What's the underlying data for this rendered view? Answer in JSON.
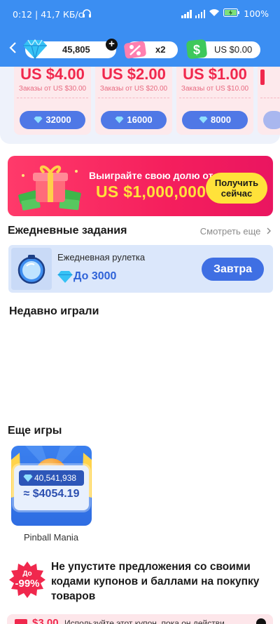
{
  "status_bar": {
    "time_speed": "0:12 | 41,7 КБ/с",
    "battery": "100%"
  },
  "header": {
    "gems": "45,805",
    "boost": "x2",
    "cash": "US $0.00",
    "colors": {
      "background": "#3b8ef2",
      "pill": "#ffffff"
    }
  },
  "coupons": [
    {
      "amount": "US $4.00",
      "condition": "Заказы от US $30.00",
      "price": "32000"
    },
    {
      "amount": "US $2.00",
      "condition": "Заказы от US $20.00",
      "price": "16000"
    },
    {
      "amount": "US $1.00",
      "condition": "Заказы от US $10.00",
      "price": "8000"
    }
  ],
  "banner": {
    "line1": "Выиграйте свою долю от",
    "line2": "US $1,000,000",
    "cta_line1": "Получить",
    "cta_line2": "сейчас",
    "colors": {
      "background": "#f51f5d",
      "accent": "#ffe23a"
    }
  },
  "daily_tasks": {
    "title": "Ежедневные задания",
    "see_all": "Смотреть еще",
    "task": {
      "name": "Ежедневная рулетка",
      "reward": "До 3000",
      "button": "Завтра"
    }
  },
  "recently_played": {
    "title": "Недавно играли"
  },
  "more_games": {
    "title": "Еще игры",
    "games": [
      {
        "name": "Pinball Mania",
        "count": "40,541,938",
        "usd": "≈ $4054.19"
      }
    ]
  },
  "offer": {
    "badge_line1": "До",
    "badge_line2": "-99%",
    "text": "Не упустите предложения со своими кодами купонов и баллами на покупку товаров"
  },
  "bottom_coupon": {
    "amount": "$3.00",
    "text": "Используйте этот купон, пока он действи"
  }
}
